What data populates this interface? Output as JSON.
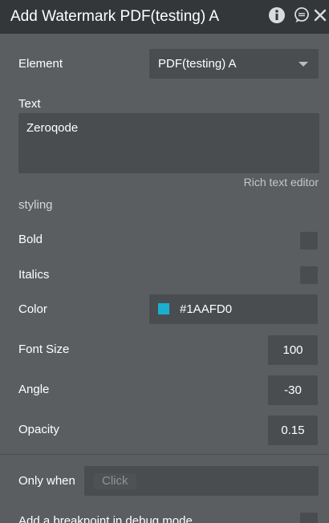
{
  "header": {
    "title": "Add Watermark PDF(testing) A (t",
    "icons": [
      "info-icon",
      "chat-icon",
      "close-icon"
    ]
  },
  "element": {
    "label": "Element",
    "selected": "PDF(testing) A"
  },
  "text": {
    "label": "Text",
    "value": "Zeroqode",
    "rich_link": "Rich text editor"
  },
  "styling": {
    "section_label": "styling",
    "bold_label": "Bold",
    "bold_checked": false,
    "italics_label": "Italics",
    "italics_checked": false,
    "color_label": "Color",
    "color_value": "#1AAFD0",
    "color_swatch": "#1AAFD0",
    "font_size_label": "Font Size",
    "font_size_value": "100",
    "angle_label": "Angle",
    "angle_value": "-30",
    "opacity_label": "Opacity",
    "opacity_value": "0.15"
  },
  "condition": {
    "label": "Only when",
    "placeholder": "Click"
  },
  "debug": {
    "label": "Add a breakpoint in debug mode",
    "checked": false
  },
  "colors": {
    "panel_bg": "#5b5e61",
    "header_bg": "#34373a",
    "field_bg": "#4a4d50",
    "accent_swatch": "#1AAFD0"
  }
}
